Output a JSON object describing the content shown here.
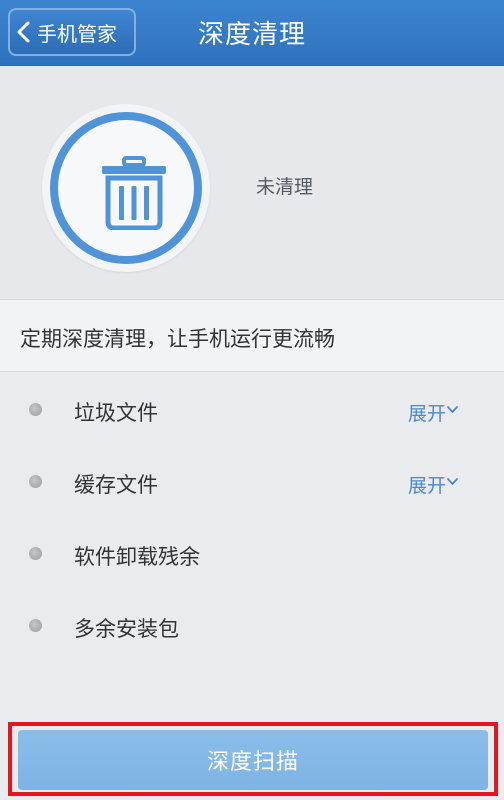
{
  "header": {
    "back_label": "手机管家",
    "title": "深度清理"
  },
  "status": {
    "icon": "trash-icon",
    "text": "未清理"
  },
  "description": "定期深度清理，让手机运行更流畅",
  "list": {
    "items": [
      {
        "label": "垃圾文件",
        "action": "展开"
      },
      {
        "label": "缓存文件",
        "action": "展开"
      },
      {
        "label": "软件卸载残余"
      },
      {
        "label": "多余安装包"
      }
    ]
  },
  "button": {
    "scan_label": "深度扫描"
  },
  "colors": {
    "header": "#3478c6",
    "accent": "#4f93d8",
    "link": "#4a88cc",
    "button": "#84b8e6",
    "highlight": "#e3171d"
  }
}
